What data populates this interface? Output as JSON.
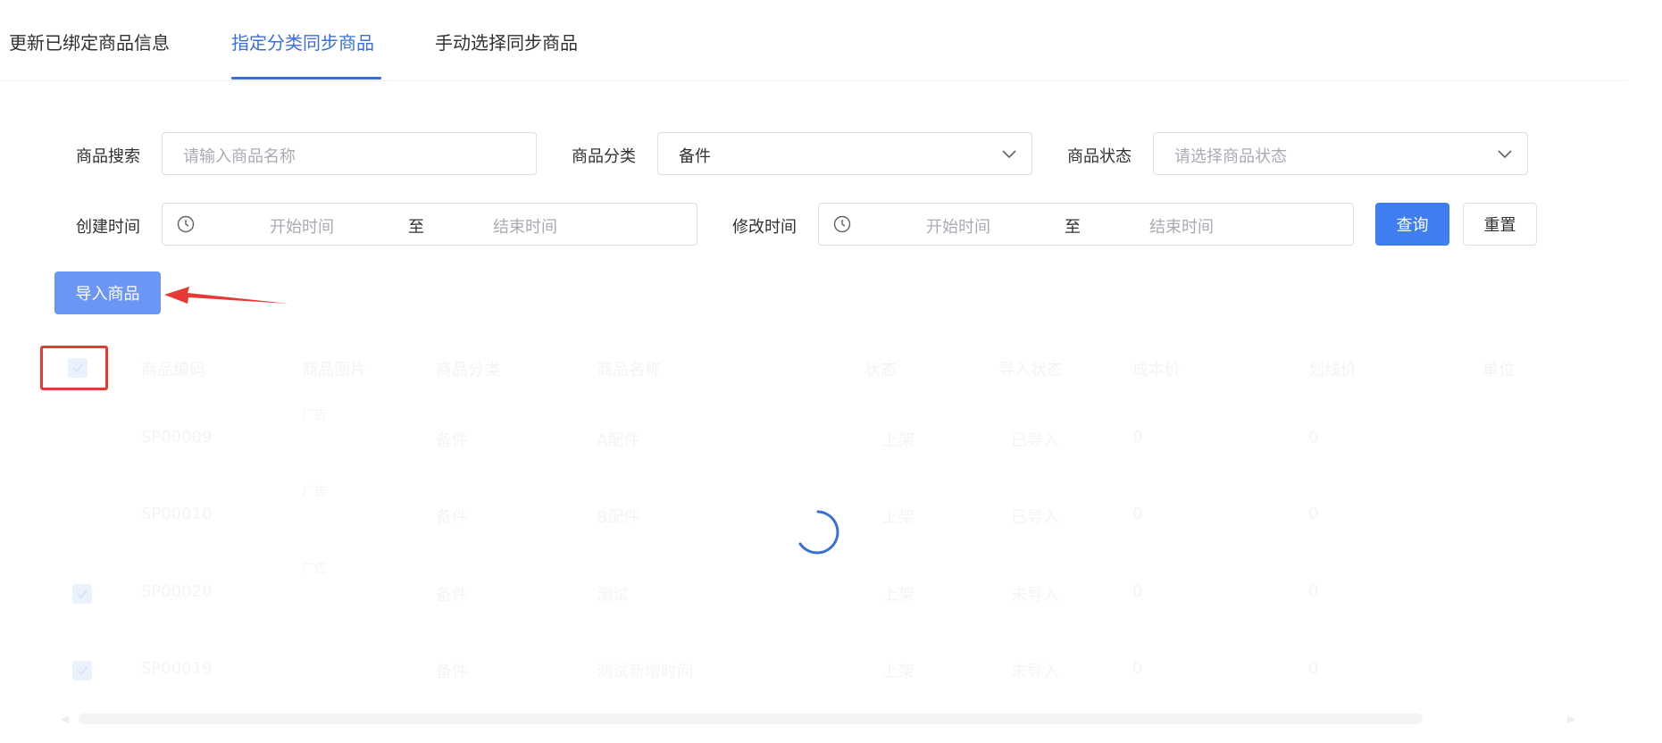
{
  "tabs": [
    {
      "label": "更新已绑定商品信息"
    },
    {
      "label": "指定分类同步商品"
    },
    {
      "label": "手动选择同步商品"
    }
  ],
  "active_tab": 1,
  "filters": {
    "search_label": "商品搜索",
    "search_placeholder": "请输入商品名称",
    "category_label": "商品分类",
    "category_value": "备件",
    "status_label": "商品状态",
    "status_placeholder": "请选择商品状态",
    "created_label": "创建时间",
    "created_start_placeholder": "开始时间",
    "created_sep": "至",
    "created_end_placeholder": "结束时间",
    "modified_label": "修改时间",
    "modified_start_placeholder": "开始时间",
    "modified_sep": "至",
    "modified_end_placeholder": "结束时间",
    "query_button": "查询",
    "reset_button": "重置"
  },
  "import_button": "导入商品",
  "table": {
    "headers": [
      "商品编码",
      "商品图片",
      "商品分类",
      "商品名称",
      "状态",
      "导入状态",
      "成本价",
      "划线价",
      "单位"
    ],
    "rows": [
      {
        "code": "SP00009",
        "image_text": "广告",
        "category": "备件",
        "name": "A配件",
        "status": "上架",
        "import_status": "已导入",
        "cost": "0",
        "list_price": "0",
        "checked": false
      },
      {
        "code": "SP00010",
        "image_text": "广告",
        "category": "备件",
        "name": "B配件",
        "status": "上架",
        "import_status": "已导入",
        "cost": "0",
        "list_price": "0",
        "checked": false
      },
      {
        "code": "SP00020",
        "image_text": "广告",
        "category": "备件",
        "name": "测试",
        "status": "上架",
        "import_status": "未导入",
        "cost": "0",
        "list_price": "0",
        "checked": true
      },
      {
        "code": "SP00019",
        "image_text": "",
        "category": "备件",
        "name": "测试新增时间",
        "status": "上架",
        "import_status": "未导入",
        "cost": "0",
        "list_price": "0",
        "checked": true
      }
    ]
  },
  "loading": true,
  "colors": {
    "accent": "#3a6fd8",
    "primary_button": "#3f7ef0",
    "import_button": "#6c96f6",
    "annotation_red": "#e53a35"
  }
}
